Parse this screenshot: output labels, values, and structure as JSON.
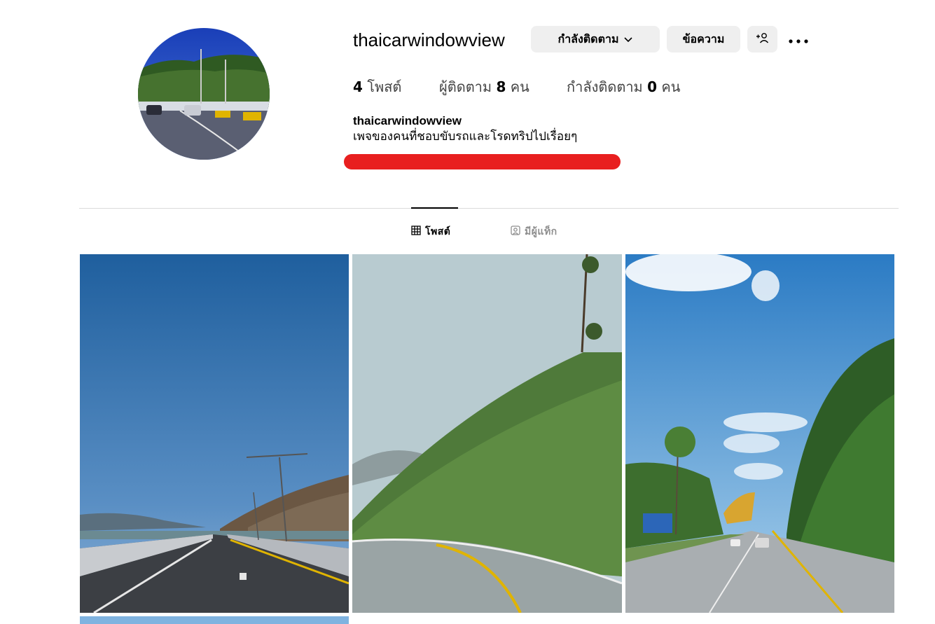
{
  "profile": {
    "username": "thaicarwindowview",
    "following_button": "กำลังติดตาม",
    "message_button": "ข้อความ",
    "stats": {
      "posts_count": "4",
      "posts_label": "โพสต์",
      "followers_label": "ผู้ติดตาม",
      "followers_count": "8",
      "followers_unit": "คน",
      "following_label": "กำลังติดตาม",
      "following_count": "0",
      "following_unit": "คน"
    },
    "bio": {
      "name": "thaicarwindowview",
      "text": "เพจของคนที่ชอบขับรถและโรดทริปไปเรื่อยๆ"
    }
  },
  "tabs": {
    "posts": "โพสต์",
    "tagged": "มีผู้แท็ก",
    "active": "posts"
  },
  "icons": {
    "chevron": "chevron-down-icon",
    "add_user": "add-user-icon",
    "more": "more-options-icon",
    "grid": "grid-icon",
    "tagged": "tagged-icon"
  },
  "colors": {
    "button_bg": "#efefef",
    "redaction": "#e81f1f",
    "divider": "#dbdbdb",
    "muted": "#8e8e8e"
  }
}
